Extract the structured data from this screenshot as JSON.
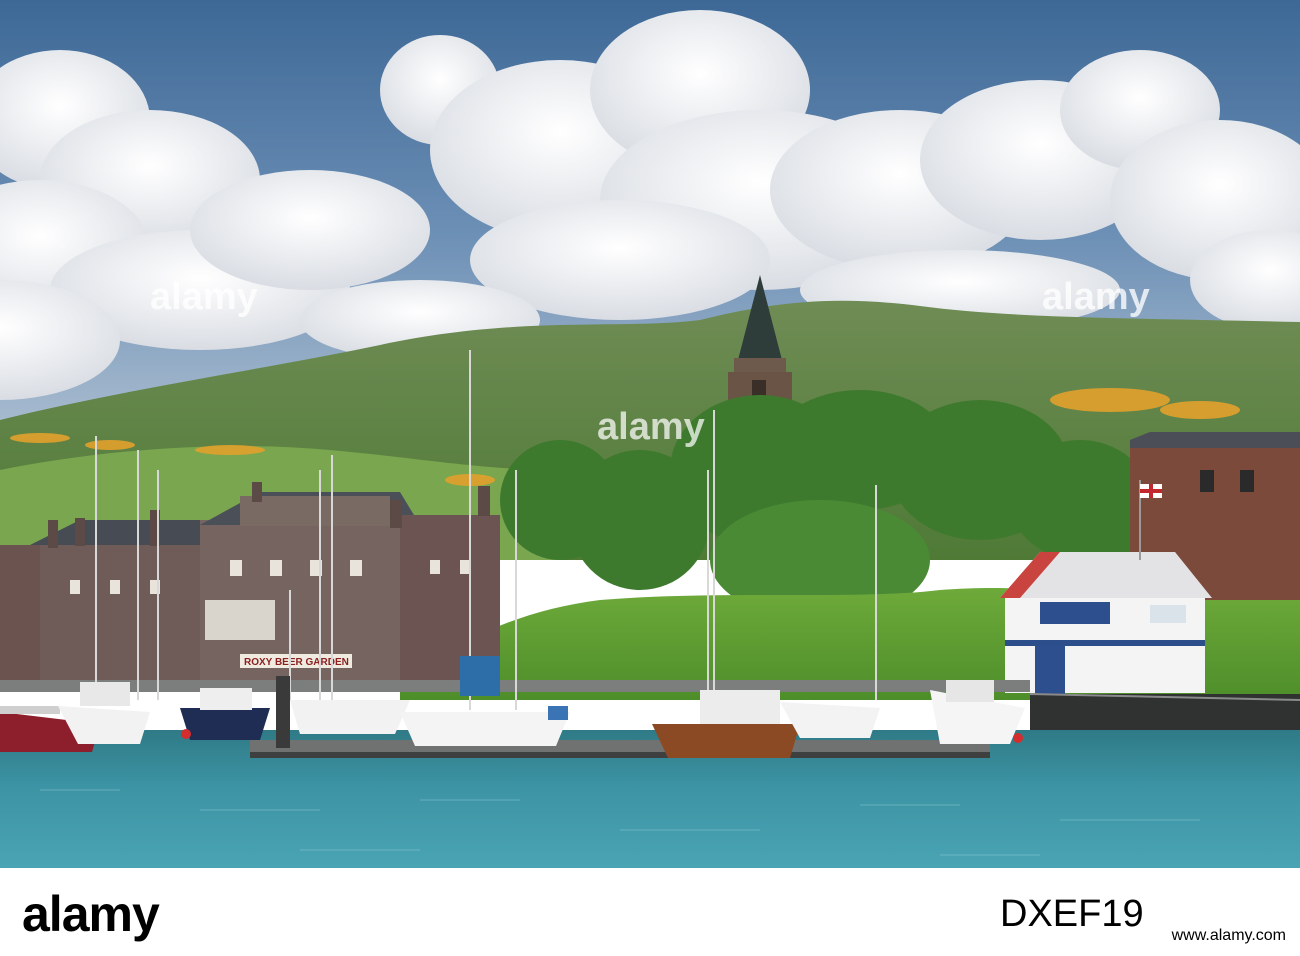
{
  "watermark": {
    "text": "alamy"
  },
  "sign": {
    "roxy": "ROXY BEER GARDEN"
  },
  "footer": {
    "brand": "alamy",
    "image_id": "DXEF19",
    "url": "www.alamy.com"
  },
  "colors": {
    "sky_top": "#3f6a9a",
    "sky_bottom": "#7f9fbf",
    "cloud": "#e9ebee",
    "hill": "#6e8f4d",
    "gorse": "#e7a528",
    "trees": "#3f7a2f",
    "water": "#3a8fa0",
    "building_stone": "#6e5a55",
    "roof_slate": "#4a4f58",
    "hull_wood": "#8b4a24",
    "hull_red": "#8c1f2b",
    "boat_white": "#f2f2f2"
  }
}
